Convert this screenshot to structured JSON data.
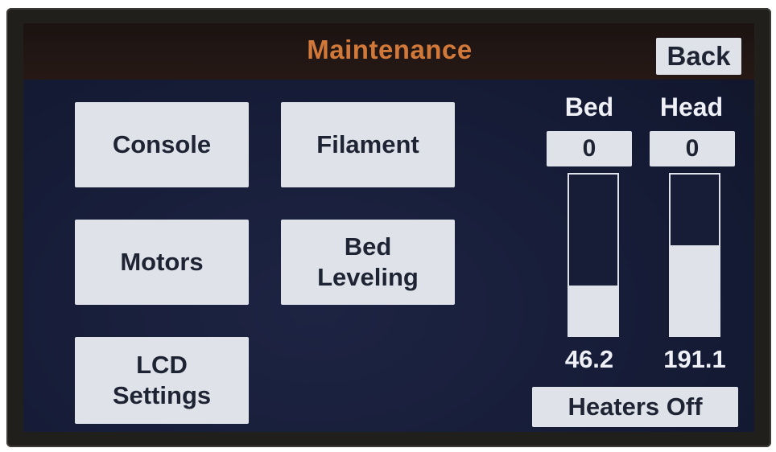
{
  "header": {
    "title": "Maintenance",
    "back_label": "Back"
  },
  "menu": {
    "console": "Console",
    "filament": "Filament",
    "motors": "Motors",
    "bed_leveling": [
      "Bed",
      "Leveling"
    ],
    "lcd_settings": [
      "LCD",
      "Settings"
    ]
  },
  "heaters": {
    "bed": {
      "label": "Bed",
      "setpoint": "0",
      "current": "46.2",
      "fill_fraction": 0.31
    },
    "head": {
      "label": "Head",
      "setpoint": "0",
      "current": "191.1",
      "fill_fraction": 0.56
    },
    "off_label": "Heaters Off"
  },
  "colors": {
    "title": "#d2793a",
    "screen_bg": "#141a33",
    "button_bg": "#dfe3e9",
    "button_text": "#1e2433",
    "label_text": "#eef0f6"
  }
}
